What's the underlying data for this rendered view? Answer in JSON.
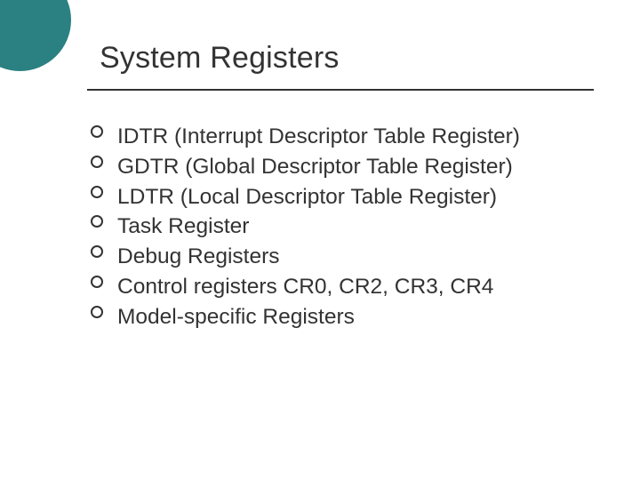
{
  "slide": {
    "title": "System Registers",
    "bullets": [
      "IDTR (Interrupt Descriptor Table Register)",
      "GDTR (Global Descriptor Table Register)",
      "LDTR (Local Descriptor Table Register)",
      "Task Register",
      "Debug Registers",
      "Control registers CR0, CR2, CR3, CR4",
      "Model-specific Registers"
    ]
  }
}
